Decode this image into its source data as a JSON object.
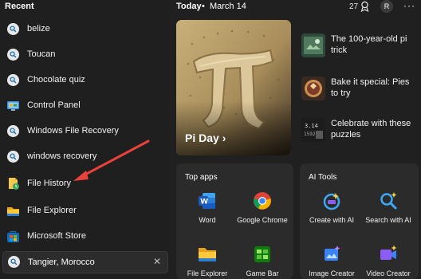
{
  "left_pane": {
    "title": "Recent",
    "items": [
      {
        "label": "belize",
        "icon": "search-icon"
      },
      {
        "label": "Toucan",
        "icon": "search-icon"
      },
      {
        "label": "Chocolate quiz",
        "icon": "search-icon"
      },
      {
        "label": "Control Panel",
        "icon": "control-panel-icon"
      },
      {
        "label": "Windows File Recovery",
        "icon": "search-icon"
      },
      {
        "label": "windows recovery",
        "icon": "search-icon"
      },
      {
        "label": "File History",
        "icon": "file-history-icon"
      },
      {
        "label": "File Explorer",
        "icon": "folder-icon"
      },
      {
        "label": "Microsoft Store",
        "icon": "store-icon"
      }
    ],
    "search": {
      "value": "Tangier, Morocco",
      "clear": "✕"
    }
  },
  "header": {
    "date_prefix": "Today",
    "separator": "•",
    "date": "March 14",
    "reward_count": "27",
    "avatar_initial": "R",
    "more": "···"
  },
  "hero": {
    "title": "Pi Day",
    "chevron": "›"
  },
  "news": [
    {
      "text": "The 100-year-old pi trick"
    },
    {
      "text": "Bake it special: Pies to try"
    },
    {
      "text": "Celebrate with these puzzles"
    }
  ],
  "top_apps": {
    "title": "Top apps",
    "apps": [
      {
        "label": "Word",
        "icon": "word-icon"
      },
      {
        "label": "Google Chrome",
        "icon": "chrome-icon"
      },
      {
        "label": "File Explorer",
        "icon": "folder-icon"
      },
      {
        "label": "Game Bar",
        "icon": "game-bar-icon"
      }
    ]
  },
  "ai_tools": {
    "title": "AI Tools",
    "tools": [
      {
        "label": "Create with AI",
        "icon": "create-ai-icon"
      },
      {
        "label": "Search with AI",
        "icon": "search-ai-icon"
      },
      {
        "label": "Image Creator",
        "icon": "image-creator-icon"
      },
      {
        "label": "Video Creator",
        "icon": "video-creator-icon"
      }
    ]
  },
  "colors": {
    "background": "#202020",
    "card": "#2b2b2b",
    "annotation_arrow": "#e8423b",
    "accent": "#0078d4"
  }
}
